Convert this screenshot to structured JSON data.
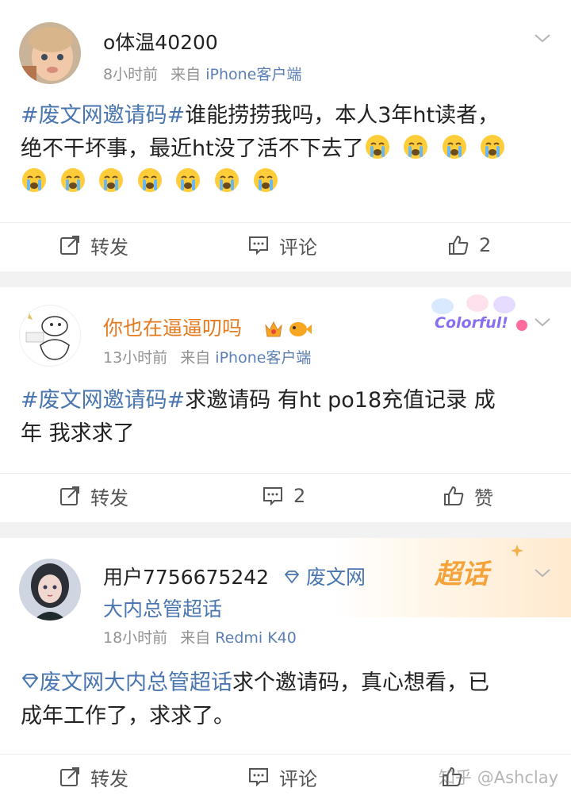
{
  "posts": [
    {
      "username": "o体温40200",
      "time": "8小时前",
      "source_prefix": "来自",
      "source": "iPhone客户端",
      "topic": "#废文网邀请码#",
      "text_line1_rest": "谁能捞捞我吗，本人3年ht读者，",
      "text_line2": "绝不干坏事，最近ht没了活不下去了",
      "emoji_name": "crying-face-icon",
      "actions": {
        "repost": "转发",
        "comment": "评论",
        "like": "2"
      }
    },
    {
      "username": "你也在逼逼叨吗",
      "badge_label": "Colorful!",
      "time": "13小时前",
      "source_prefix": "来自",
      "source": "iPhone客户端",
      "topic": "#废文网邀请码#",
      "text_rest": "求邀请码 有ht po18充值记录 成",
      "text_line2": "年 我求求了",
      "actions": {
        "repost": "转发",
        "comment": "2",
        "like": "赞"
      }
    },
    {
      "username": "用户7756675242",
      "super_topic": "废文网",
      "super_topic_line2": "大内总管超话",
      "super_badge": "超话",
      "time": "18小时前",
      "source_prefix": "来自",
      "source": "Redmi K40",
      "topic": "废文网大内总管超话",
      "text_rest": "求个邀请码，真心想看，已",
      "text_line2": "成年工作了，求求了。",
      "actions": {
        "repost": "转发",
        "comment": "评论"
      }
    }
  ],
  "watermark": "知乎 @Ashclay",
  "colors": {
    "topic": "#4a76b0",
    "username_orange": "#e57a1f",
    "meta_gray": "#939393"
  }
}
